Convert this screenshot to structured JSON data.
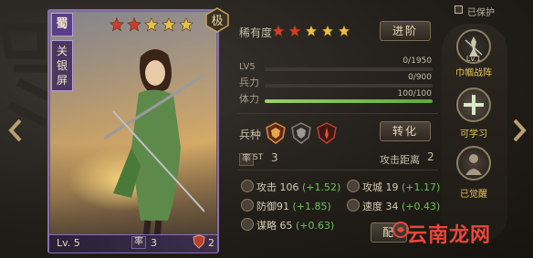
{
  "card": {
    "faction": "蜀",
    "name": "关银屏",
    "rank_glyph": "极",
    "stars": 5,
    "level": "Lv. 5",
    "rate_label": "率",
    "rate_value": "3",
    "power_value": "2"
  },
  "info": {
    "rarity_label": "稀有度",
    "rarity_stars": 5,
    "advance_button": "进阶",
    "level_label": "LV5",
    "exp_value": "0/1950",
    "exp_fraction": 0,
    "troop_label": "兵力",
    "troop_value": "0/900",
    "troop_fraction": 0,
    "stamina_label": "体力",
    "stamina_value": "100/100",
    "stamina_fraction": 1,
    "arms_label": "兵种",
    "transform_button": "转化",
    "cost_label": "率",
    "cost_suffix": "ST",
    "cost_value": "3",
    "range_label": "攻击距离",
    "range_value": "2",
    "config_button": "配"
  },
  "attributes": [
    {
      "name": "攻击",
      "base": "106",
      "bonus": "(+1.52)"
    },
    {
      "name": "攻城",
      "base": "19",
      "bonus": "(+1.17)"
    },
    {
      "name": "防御",
      "base": "91",
      "bonus": "(+1.85)"
    },
    {
      "name": "速度",
      "base": "34",
      "bonus": "(+0.43)"
    },
    {
      "name": "谋略",
      "base": "65",
      "bonus": "(+0.63)"
    }
  ],
  "skills": {
    "protect_label": "已保护",
    "items": [
      {
        "label": "巾帼战阵",
        "level": "Lv.1"
      },
      {
        "label": "可学习"
      },
      {
        "label": "已觉醒"
      }
    ]
  },
  "watermark": "云南龙网",
  "colors": {
    "star": "#e6c24a",
    "star_red": "#d43a2c",
    "bonus": "#6fc05a",
    "accent_purple": "#8a6fb0",
    "skill_label": "#e8c45a"
  }
}
